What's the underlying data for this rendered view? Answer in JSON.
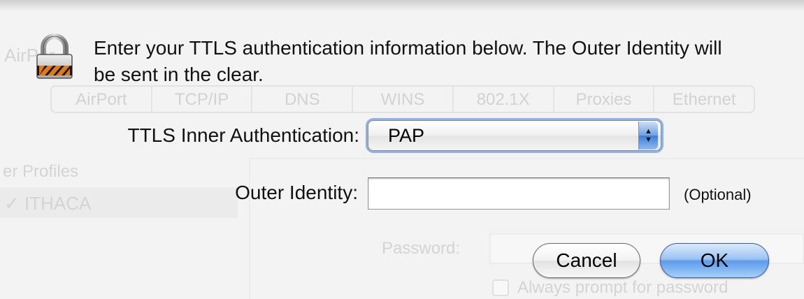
{
  "background": {
    "airport_fragment": "AirPor",
    "tabs": [
      "AirPort",
      "TCP/IP",
      "DNS",
      "WINS",
      "802.1X",
      "Proxies",
      "Ethernet"
    ],
    "profiles_heading": "er Profiles",
    "profile_item": "✓ ITHACA",
    "password_label": "Password:",
    "always_prompt": "Always prompt for password"
  },
  "dialog": {
    "message": "Enter your TTLS authentication information below. The Outer Identity will be sent in the clear.",
    "inner_auth_label": "TTLS Inner Authentication:",
    "inner_auth_value": "PAP",
    "outer_identity_label": "Outer Identity:",
    "outer_identity_value": "",
    "optional_label": "(Optional)",
    "cancel_label": "Cancel",
    "ok_label": "OK"
  },
  "colors": {
    "focus_ring": "#8fb3e6",
    "default_button": "#5d9bea"
  },
  "icons": {
    "lock": "lock-icon",
    "popup_arrows": "up-down-arrows-icon"
  }
}
